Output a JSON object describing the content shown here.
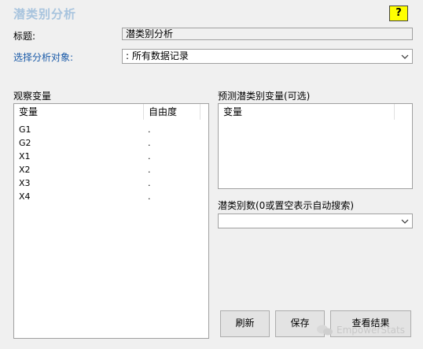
{
  "window": {
    "title": "潜类别分析",
    "help_label": "?"
  },
  "form": {
    "title_label": "标题:",
    "title_value": "潜类别分析",
    "target_label": "选择分析对象:",
    "target_value": ": 所有数据记录"
  },
  "observed": {
    "section_label": "观察变量",
    "col_variable": "变量",
    "col_df": "自由度",
    "rows": [
      {
        "name": "G1",
        "df": "."
      },
      {
        "name": "G2",
        "df": "."
      },
      {
        "name": "X1",
        "df": "."
      },
      {
        "name": "X2",
        "df": "."
      },
      {
        "name": "X3",
        "df": "."
      },
      {
        "name": "X4",
        "df": "."
      }
    ]
  },
  "predictors": {
    "section_label": "预测潜类别变量(可选)",
    "col_variable": "变量"
  },
  "classes": {
    "label": "潜类别数(0或置空表示自动搜索)",
    "value": ""
  },
  "buttons": {
    "refresh": "刷新",
    "save": "保存",
    "view": "查看结果"
  },
  "watermark": "EmpowerStats"
}
